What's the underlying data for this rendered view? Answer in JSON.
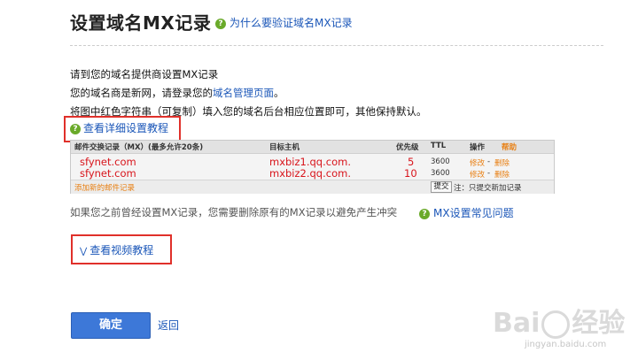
{
  "header": {
    "title": "设置域名MX记录",
    "why_link": "为什么要验证域名MX记录"
  },
  "instructions": {
    "line1": "请到您的域名提供商设置MX记录",
    "line2_prefix": "您的域名商是新网，请登录您的",
    "line2_link": "域名管理页面",
    "line2_suffix": "。",
    "line3": "将图中红色字符串（可复制）填入您的域名后台相应位置即可，其他保持默认。",
    "detail_tutorial": "查看详细设置教程"
  },
  "table": {
    "headers": {
      "record": "邮件交换记录（MX）(最多允许20条)",
      "host": "目标主机",
      "priority": "优先级",
      "ttl": "TTL",
      "action": "操作",
      "help": "帮助"
    },
    "rows": [
      {
        "record": "sfynet.com",
        "host": "mxbiz1.qq.com.",
        "priority": "5",
        "ttl": "3600",
        "edit": "修改",
        "delete": "删除"
      },
      {
        "record": "sfynet.com",
        "host": "mxbiz2.qq.com.",
        "priority": "10",
        "ttl": "3600",
        "edit": "修改",
        "delete": "删除"
      }
    ],
    "add_link": "添加新的邮件记录",
    "submit": "提交",
    "note": "注：只提交新加记录"
  },
  "info": {
    "text": "如果您之前曾经设置MX记录，您需要删除原有的MX记录以避免产生冲突",
    "faq": "MX设置常见问题"
  },
  "video": {
    "label": "查看视频教程"
  },
  "footer": {
    "confirm": "确定",
    "back": "返回"
  },
  "watermark": {
    "brand_left": "Bai",
    "brand_right": "经验",
    "url": "jingyan.baidu.com"
  },
  "colors": {
    "accent_red": "#d8141b",
    "link_blue": "#1a56b8",
    "button_blue": "#3d78d8",
    "highlight_box": "#e0302a"
  }
}
